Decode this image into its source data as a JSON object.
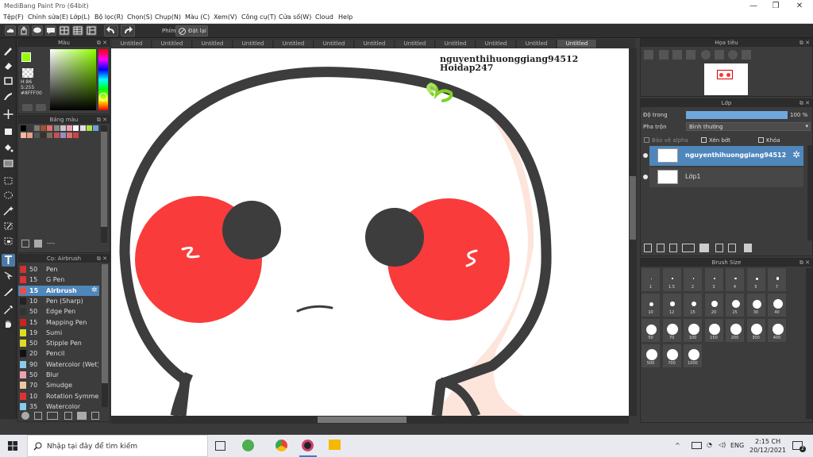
{
  "window": {
    "title": "MediBang Paint Pro (64bit)",
    "controls": [
      "—",
      "❐",
      "✕"
    ]
  },
  "menu": [
    "Tệp(F)",
    "Chỉnh sửa(E)",
    "Lớp(L)",
    "Bộ lọc(R)",
    "Chọn(S)",
    "Chụp(N)",
    "Màu (C)",
    "Xem(V)",
    "Công cụ(T)",
    "Cửa số(W)",
    "Cloud",
    "Help"
  ],
  "toolbar": {
    "brush_label": "Phím",
    "reset_label": "Đặt lại"
  },
  "color_panel": {
    "title": "Màu",
    "h": "H:86",
    "s": "S:255",
    "hex": "#8FFF00",
    "fg_color": "#8fff00"
  },
  "palette_panel": {
    "title": "Bảng màu",
    "swatches_row1": [
      "#000000",
      "#3a3a3a",
      "#7a7a7a",
      "#a0522d",
      "#e07070",
      "#888888",
      "#c8c8c8",
      "#f0a0b0",
      "#ffffff",
      "#e0e0e0",
      "#b0e040",
      "#6aa0e0"
    ],
    "swatches_row2": [
      "#f6b8a4",
      "#e8a088",
      "#555555",
      "#333333",
      "#7a6a5a",
      "#c85050",
      "#9090c0",
      "#d87070",
      "#cc4444"
    ],
    "footer_text": "----"
  },
  "brush_panel": {
    "title": "Cọ: Airbrush",
    "items": [
      {
        "size": "50",
        "name": "Pen",
        "color": "#cc3333"
      },
      {
        "size": "15",
        "name": "G Pen",
        "color": "#dd3333"
      },
      {
        "size": "15",
        "name": "Airbrush",
        "color": "#e05050"
      },
      {
        "size": "10",
        "name": "Pen (Sharp)",
        "color": "#222222"
      },
      {
        "size": "50",
        "name": "Edge Pen",
        "color": "#333333"
      },
      {
        "size": "15",
        "name": "Mapping Pen",
        "color": "#cc2222"
      },
      {
        "size": "19",
        "name": "Sumi",
        "color": "#dddd22"
      },
      {
        "size": "50",
        "name": "Stipple Pen",
        "color": "#dddd22"
      },
      {
        "size": "20",
        "name": "Pencil",
        "color": "#111111"
      },
      {
        "size": "90",
        "name": "Watercolor (Wet)",
        "color": "#88ccee"
      },
      {
        "size": "50",
        "name": "Blur",
        "color": "#f0a0b0"
      },
      {
        "size": "70",
        "name": "Smudge",
        "color": "#f0c8a0"
      },
      {
        "size": "10",
        "name": "Rotation Symmetry",
        "color": "#dd3333"
      },
      {
        "size": "35",
        "name": "Watercolor",
        "color": "#88ccee"
      }
    ]
  },
  "tabs": [
    "Untitled",
    "Untitled",
    "Untitled",
    "Untitled",
    "Untitled",
    "Untitled",
    "Untitled",
    "Untitled",
    "Untitled",
    "Untitled",
    "Untitled",
    "Untitled"
  ],
  "canvas": {
    "watermark_line1": "nguyenthihuonggiang94512",
    "watermark_line2": "Hoidap247"
  },
  "navigator": {
    "title": "Họa tiêu"
  },
  "layer_panel": {
    "title": "Lớp",
    "opacity_label": "Độ trong",
    "opacity_value": "100 %",
    "opacity_fraction": 1.0,
    "blend_label": "Pha trộn",
    "blend_value": "Bình thường",
    "protect_alpha": "Bảo vệ alpha",
    "clip": "Xén bớt",
    "lock": "Khóa",
    "layers": [
      {
        "name": "nguyenthihuonggiang94512",
        "selected": true
      },
      {
        "name": "Lớp1",
        "selected": false
      }
    ]
  },
  "brush_size_panel": {
    "title": "Brush Size",
    "sizes": [
      "1",
      "1.5",
      "2",
      "3",
      "4",
      "5",
      "7",
      "10",
      "12",
      "15",
      "20",
      "25",
      "30",
      "40",
      "50",
      "70",
      "100",
      "150",
      "200",
      "300",
      "400",
      "500",
      "700",
      "1000"
    ]
  },
  "taskbar": {
    "search_placeholder": "Nhập tại đây để tìm kiếm",
    "lang": "ENG",
    "time": "2:15 CH",
    "date": "20/12/2021",
    "notif_count": "2"
  }
}
